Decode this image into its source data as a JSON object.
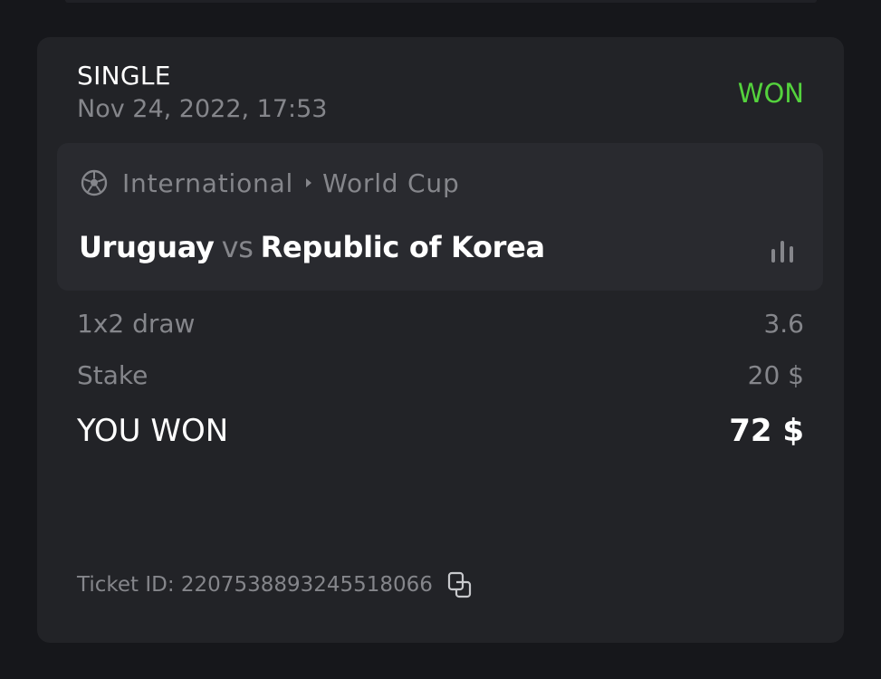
{
  "ticket": {
    "type": "SINGLE",
    "date": "Nov 24, 2022, 17:53",
    "status": "WON",
    "status_color": "#54d23d"
  },
  "event": {
    "sport_icon": "soccer-ball-icon",
    "category": "International",
    "separator_icon": "caret-right-icon",
    "league": "World Cup",
    "home_team": "Uruguay",
    "vs_label": "vs",
    "away_team": "Republic of Korea",
    "stats_icon": "bar-chart-icon"
  },
  "selection": {
    "market": "1x2 draw",
    "odds": "3.6"
  },
  "stake": {
    "label": "Stake",
    "value": "20 $"
  },
  "result": {
    "label": "YOU WON",
    "value": "72 $"
  },
  "footer": {
    "ticket_id_text": "Ticket ID: 2207538893245518066",
    "copy_icon": "copy-icon"
  }
}
